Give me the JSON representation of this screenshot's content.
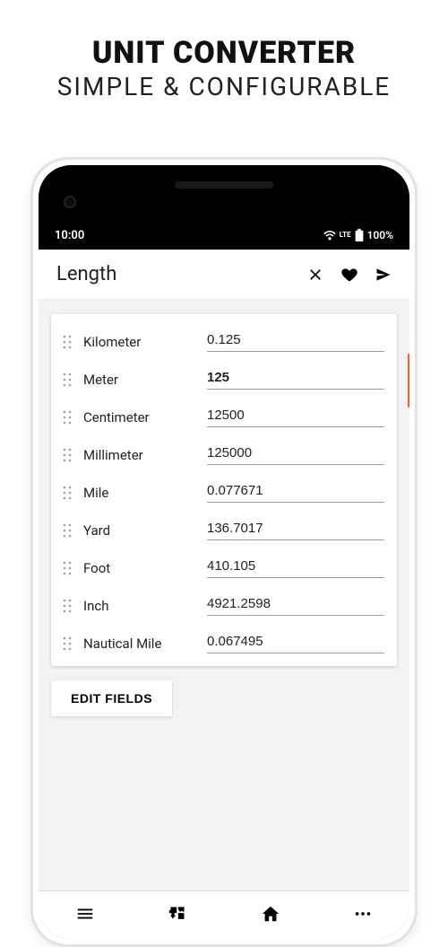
{
  "promo": {
    "line1": "UNIT CONVERTER",
    "line2": "SIMPLE & CONFIGURABLE"
  },
  "status": {
    "time": "10:00",
    "network": "LTE",
    "battery": "100%"
  },
  "appbar": {
    "title": "Length",
    "close": "close-icon",
    "favorite": "heart-icon",
    "share": "share-icon"
  },
  "units": [
    {
      "label": "Kilometer",
      "value": "0.125",
      "bold": false
    },
    {
      "label": "Meter",
      "value": "125",
      "bold": true
    },
    {
      "label": "Centimeter",
      "value": "12500",
      "bold": false
    },
    {
      "label": "Millimeter",
      "value": "125000",
      "bold": false
    },
    {
      "label": "Mile",
      "value": "0.077671",
      "bold": false
    },
    {
      "label": "Yard",
      "value": "136.7017",
      "bold": false
    },
    {
      "label": "Foot",
      "value": "410.105",
      "bold": false
    },
    {
      "label": "Inch",
      "value": "4921.2598",
      "bold": false
    },
    {
      "label": "Nautical Mile",
      "value": "0.067495",
      "bold": false
    }
  ],
  "buttons": {
    "edit_fields": "EDIT FIELDS"
  },
  "nav": {
    "menu": "menu-icon",
    "calc": "calc-icon",
    "home": "home-icon",
    "more": "more-icon"
  }
}
